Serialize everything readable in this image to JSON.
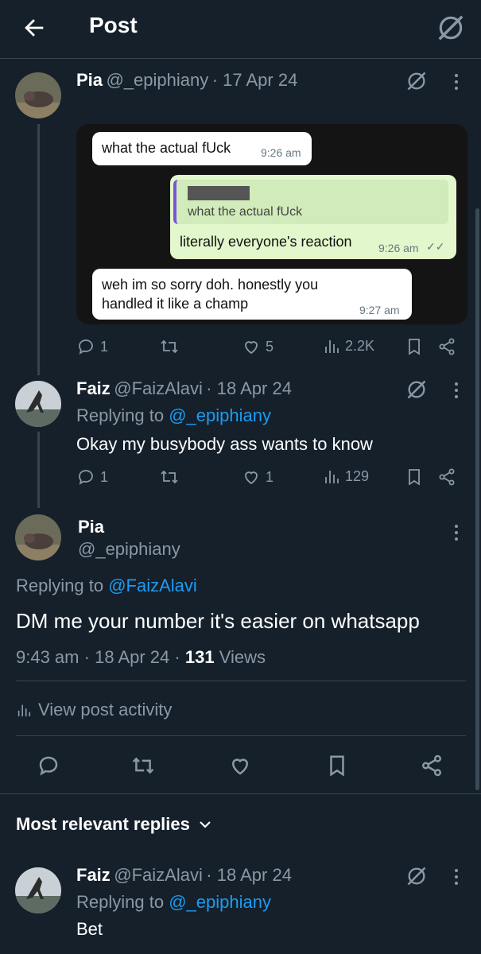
{
  "header": {
    "title": "Post"
  },
  "thread": {
    "post1": {
      "author": "Pia",
      "handle": "@_epiphiany",
      "date": "· 17 Apr 24",
      "image": {
        "msg1": {
          "text": "what the actual fUck",
          "time": "9:26 am"
        },
        "msg2": {
          "quoted": "what the actual fUck",
          "text": "literally everyone's reaction",
          "time": "9:26 am"
        },
        "msg3": {
          "line1": "weh im so sorry doh. honestly you",
          "line2": "handled it like a champ",
          "time": "9:27 am"
        }
      },
      "stats": {
        "replies": "1",
        "likes": "5",
        "views": "2.2K"
      }
    },
    "post2": {
      "author": "Faiz",
      "handle": "@FaizAlavi",
      "date": "· 18 Apr 24",
      "replying_prefix": "Replying to",
      "replying_to": "@_epiphiany",
      "text": "Okay my busybody ass wants to know",
      "stats": {
        "replies": "1",
        "likes": "1",
        "views": "129"
      }
    }
  },
  "main_post": {
    "author": "Pia",
    "handle": "@_epiphiany",
    "replying_prefix": "Replying to",
    "replying_to": "@FaizAlavi",
    "text": "DM me your number it's easier on whatsapp",
    "time": "9:43 am",
    "date": "18 Apr 24",
    "views_count": "131",
    "views_label": "Views",
    "activity_label": "View post activity"
  },
  "replies": {
    "section_label": "Most relevant replies",
    "reply1": {
      "author": "Faiz",
      "handle": "@FaizAlavi",
      "date": "· 18 Apr 24",
      "replying_prefix": "Replying to",
      "replying_to": "@_epiphiany",
      "text": "Bet"
    }
  },
  "colors": {
    "background": "#15202b",
    "link": "#1d9bf0",
    "muted": "#8b98a5",
    "border": "#38444d"
  }
}
